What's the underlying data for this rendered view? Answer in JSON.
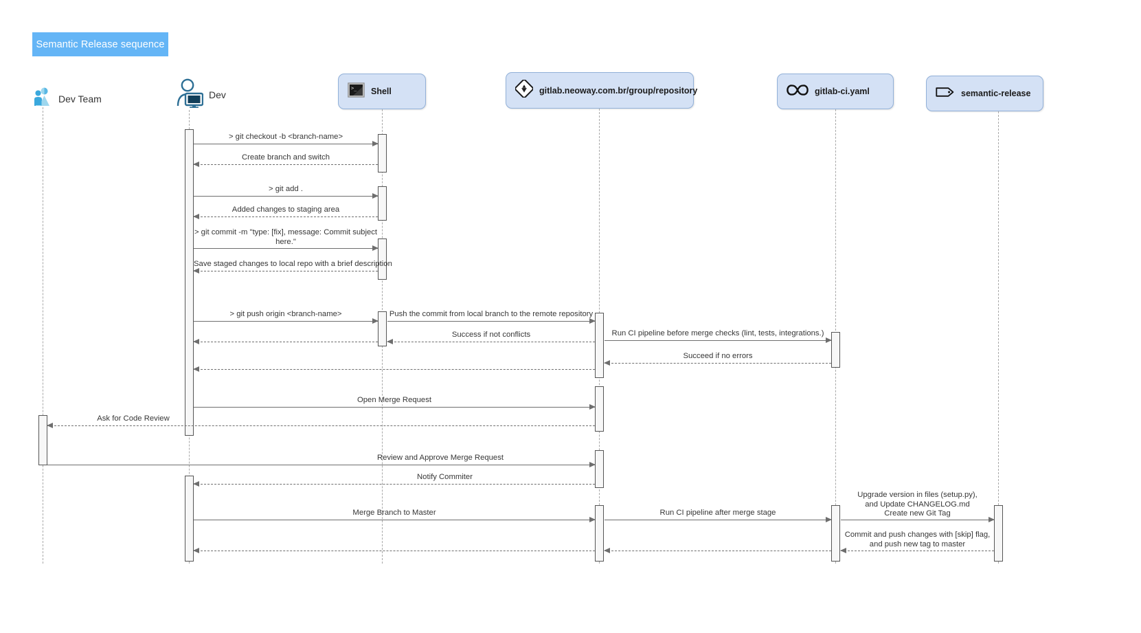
{
  "diagram": {
    "title": "Semantic Release sequence",
    "title_bg": "#64b5f6",
    "participant_bg": "#d4e1f5",
    "participant_border": "#91b0d8",
    "line_color": "#6e6e6e",
    "lifeline_color": "#a8a8a8"
  },
  "participants": [
    {
      "id": "devteam",
      "label": "Dev Team",
      "icon": "dev-team-icon",
      "style": "plain"
    },
    {
      "id": "dev",
      "label": "Dev",
      "icon": "dev-user-icon",
      "style": "plain"
    },
    {
      "id": "shell",
      "label": "Shell",
      "icon": "terminal-icon",
      "style": "box"
    },
    {
      "id": "repository",
      "label": "gitlab.neoway.com.br/group/repository",
      "icon": "gitlab-icon",
      "style": "box"
    },
    {
      "id": "gitlabci",
      "label": "gitlab-ci.yaml",
      "icon": "infinity-icon",
      "style": "box"
    },
    {
      "id": "semrel",
      "label": "semantic-release",
      "icon": "tag-icon",
      "style": "box"
    }
  ],
  "messages": [
    {
      "id": "m1",
      "from": "dev",
      "to": "shell",
      "label": "> git checkout -b <branch-name>",
      "kind": "call"
    },
    {
      "id": "m2",
      "from": "shell",
      "to": "dev",
      "label": "Create branch and switch",
      "kind": "return"
    },
    {
      "id": "m3",
      "from": "dev",
      "to": "shell",
      "label": "> git add .",
      "kind": "call"
    },
    {
      "id": "m4",
      "from": "shell",
      "to": "dev",
      "label": "Added changes to staging area",
      "kind": "return"
    },
    {
      "id": "m5",
      "from": "dev",
      "to": "shell",
      "label": "> git commit -m \"type: [fix], message: Commit subject\nhere.\"",
      "kind": "call"
    },
    {
      "id": "m6",
      "from": "shell",
      "to": "dev",
      "label": "Save staged changes to local repo with a brief description",
      "kind": "return"
    },
    {
      "id": "m7",
      "from": "dev",
      "to": "shell",
      "label": "> git push origin <branch-name>",
      "kind": "call"
    },
    {
      "id": "m8",
      "from": "shell",
      "to": "repository",
      "label": "Push the commit from local branch to the remote repository",
      "kind": "call"
    },
    {
      "id": "m9",
      "from": "repository",
      "to": "gitlabci",
      "label": "Run CI pipeline before merge checks (lint, tests, integrations.)",
      "kind": "call"
    },
    {
      "id": "m10",
      "from": "repository",
      "to": "shell",
      "label": "Success if not conflicts",
      "kind": "return"
    },
    {
      "id": "m11",
      "from": "shell",
      "to": "dev",
      "label": "",
      "kind": "return"
    },
    {
      "id": "m12",
      "from": "gitlabci",
      "to": "repository",
      "label": "Succeed if no errors",
      "kind": "return"
    },
    {
      "id": "m13",
      "from": "repository",
      "to": "dev",
      "label": "",
      "kind": "return"
    },
    {
      "id": "m14",
      "from": "dev",
      "to": "repository",
      "label": "Open Merge Request",
      "kind": "call"
    },
    {
      "id": "m15",
      "from": "repository",
      "to": "devteam",
      "label": "Ask for Code Review",
      "kind": "return"
    },
    {
      "id": "m16",
      "from": "devteam",
      "to": "repository",
      "label": "Review and Approve Merge Request",
      "kind": "call"
    },
    {
      "id": "m17",
      "from": "repository",
      "to": "dev",
      "label": "Notify Commiter",
      "kind": "return"
    },
    {
      "id": "m18",
      "from": "dev",
      "to": "repository",
      "label": "Merge Branch to Master",
      "kind": "call"
    },
    {
      "id": "m19",
      "from": "repository",
      "to": "gitlabci",
      "label": "Run CI pipeline after merge stage",
      "kind": "call"
    },
    {
      "id": "m20",
      "from": "gitlabci",
      "to": "semrel",
      "label": "Upgrade version in files (setup.py),\nand Update CHANGELOG.md\nCreate new Git Tag",
      "kind": "call"
    },
    {
      "id": "m21",
      "from": "semrel",
      "to": "gitlabci",
      "label": "Commit and push changes with [skip] flag,\nand push new tag to master",
      "kind": "return"
    },
    {
      "id": "m22",
      "from": "gitlabci",
      "to": "repository",
      "label": "",
      "kind": "return"
    },
    {
      "id": "m23",
      "from": "repository",
      "to": "dev",
      "label": "",
      "kind": "return"
    }
  ]
}
